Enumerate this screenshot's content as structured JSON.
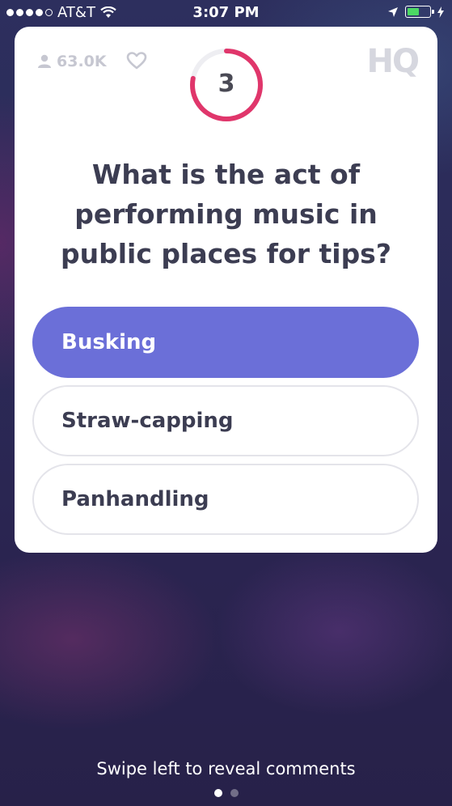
{
  "status_bar": {
    "carrier": "AT&T",
    "time": "3:07 PM",
    "signal_bars_filled": 4,
    "signal_bars_total": 5,
    "battery_level": 0.55,
    "battery_color": "#4cd964"
  },
  "game": {
    "viewer_count": "63.0K",
    "logo": "HQ",
    "timer": "3",
    "timer_remaining_fraction": 0.78,
    "timer_color": "#e0366b",
    "question": "What is the act of performing music in public places for tips?",
    "answers": [
      {
        "label": "Busking",
        "selected": true
      },
      {
        "label": "Straw-capping",
        "selected": false
      },
      {
        "label": "Panhandling",
        "selected": false
      }
    ],
    "accent_color": "#6b6fd8"
  },
  "footer": {
    "hint": "Swipe left to reveal comments",
    "page_index": 1,
    "page_count": 2
  }
}
